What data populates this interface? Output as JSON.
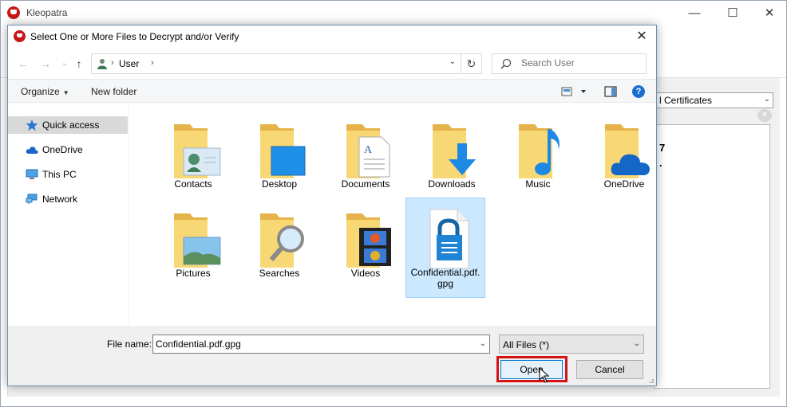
{
  "main_window": {
    "title": "Kleopatra",
    "controls": {
      "minimize": "—",
      "maximize": "☐",
      "close": "✕"
    },
    "filter_combo_text": "l Certificates",
    "clear_symbol": "✕",
    "panel_fragment_1": "7",
    "panel_fragment_2": "."
  },
  "dialog": {
    "title": "Select One or More Files to Decrypt and/or Verify",
    "close_symbol": "✕",
    "address": {
      "back": "←",
      "forward": "→",
      "recent": "⌄",
      "up": "↑",
      "crumb_sep": "›",
      "crumb": "User",
      "crumb_sep_trailing": "›",
      "dropdown": "⌄",
      "refresh": "↻"
    },
    "search": {
      "placeholder": "Search User"
    },
    "command_bar": {
      "organize": "Organize",
      "organize_caret": "▼",
      "new_folder": "New folder",
      "view_caret": "▼",
      "help": "?"
    },
    "nav_pane": [
      {
        "label": "Quick access",
        "icon": "star-icon"
      },
      {
        "label": "OneDrive",
        "icon": "cloud-icon"
      },
      {
        "label": "This PC",
        "icon": "monitor-icon"
      },
      {
        "label": "Network",
        "icon": "network-icon"
      }
    ],
    "files": [
      {
        "label": "Contacts",
        "icon": "contacts-folder-icon"
      },
      {
        "label": "Desktop",
        "icon": "desktop-folder-icon"
      },
      {
        "label": "Documents",
        "icon": "documents-folder-icon"
      },
      {
        "label": "Downloads",
        "icon": "downloads-folder-icon"
      },
      {
        "label": "Music",
        "icon": "music-folder-icon"
      },
      {
        "label": "OneDrive",
        "icon": "onedrive-folder-icon"
      },
      {
        "label": "Pictures",
        "icon": "pictures-folder-icon"
      },
      {
        "label": "Searches",
        "icon": "searches-folder-icon"
      },
      {
        "label": "Videos",
        "icon": "videos-folder-icon"
      },
      {
        "label": "Confidential.pdf.\ngpg",
        "icon": "encrypted-file-icon",
        "selected": true
      }
    ],
    "bottom": {
      "file_name_label": "File name:",
      "file_name_value": "Confidential.pdf.gpg",
      "file_name_dropdown": "⌄",
      "file_type": "All Files (*)",
      "file_type_dropdown": "⌄",
      "open_label": "Open",
      "cancel_label": "Cancel"
    }
  },
  "colors": {
    "accent_blue": "#1c6fd1",
    "folder_yellow": "#f8d775",
    "selection_bg": "#cce8ff",
    "highlight_red": "#d41414"
  }
}
